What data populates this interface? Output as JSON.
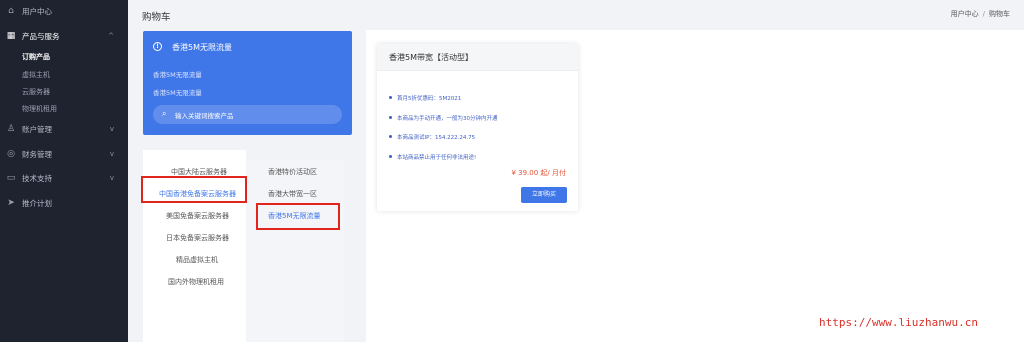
{
  "sidebar": {
    "items": [
      {
        "label": "用户中心",
        "icon": "home-icon"
      },
      {
        "label": "产品与服务",
        "icon": "grid-icon"
      },
      {
        "label": "账户管理",
        "icon": "user-icon"
      },
      {
        "label": "财务管理",
        "icon": "money-icon"
      },
      {
        "label": "技术支持",
        "icon": "tech-icon"
      },
      {
        "label": "推介计划",
        "icon": "send-icon"
      }
    ],
    "subitems": [
      "订购产品",
      "虚拟主机",
      "云服务器",
      "物理机租用"
    ],
    "expand_chevron": "^",
    "collapse_chevron": "v"
  },
  "header": {
    "title": "购物车",
    "breadcrumb": [
      "用户中心",
      "购物车"
    ],
    "breadcrumb_sep": "/"
  },
  "blue_card": {
    "title": "香港5M无限流量",
    "lines": [
      "香港5M无限流量",
      "香港5M无限流量"
    ],
    "search_placeholder": "输入关键词搜索产品"
  },
  "categories": {
    "left": [
      "中国大陆云服务器",
      "中国香港免备案云服务器",
      "美国免备案云服务器",
      "日本免备案云服务器",
      "精品虚拟主机",
      "国内外物理机租用"
    ],
    "right": [
      "香港特价活动区",
      "香港大带宽一区",
      "香港5M无限流量"
    ]
  },
  "product": {
    "title": "香港5M带宽【活动型】",
    "features": [
      "首月5折优惠码：5M2021",
      "本商品为手动开通，一般为30分钟内开通",
      "本商品测试IP：154.222.24.75",
      "本站商品禁止用于任何非法用途!"
    ],
    "price": "¥ 39.00 起/ 月付",
    "buy_label": "立即购买"
  },
  "watermark": "https://www.liuzhanwu.cn"
}
